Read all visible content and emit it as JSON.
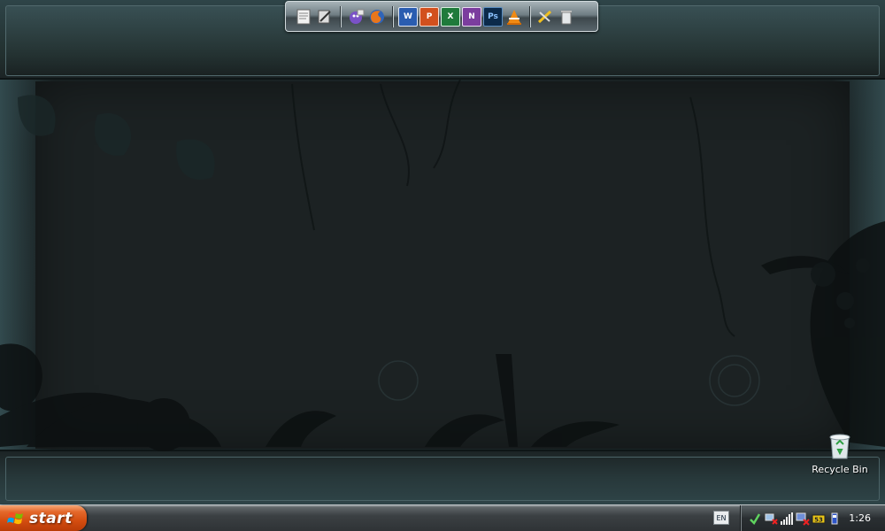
{
  "desktop": {
    "icons": [
      {
        "label": "Recycle Bin",
        "icon": "recycle-bin-icon"
      }
    ]
  },
  "dock": {
    "items": [
      {
        "name": "notepad-icon"
      },
      {
        "name": "tools-icon"
      },
      {
        "name": "messenger-icon"
      },
      {
        "name": "firefox-icon"
      },
      {
        "name": "word-icon",
        "glyph": "W"
      },
      {
        "name": "powerpoint-icon",
        "glyph": "P"
      },
      {
        "name": "excel-icon",
        "glyph": "X"
      },
      {
        "name": "onenote-icon",
        "glyph": "N"
      },
      {
        "name": "photoshop-icon",
        "glyph": "Ps"
      },
      {
        "name": "vlc-icon"
      },
      {
        "name": "utilities-icon"
      },
      {
        "name": "trash-icon"
      }
    ]
  },
  "taskbar": {
    "start_label": "start",
    "language": "EN",
    "clock": "1:26",
    "tray_icons": [
      "update-icon",
      "network-icon",
      "signal-icon",
      "network-disconnected-icon",
      "battery-icon",
      "usb-icon"
    ]
  },
  "colors": {
    "start_button": "#d44d10",
    "wallpaper": "#1b2224",
    "taskbar": "#3b4043"
  }
}
